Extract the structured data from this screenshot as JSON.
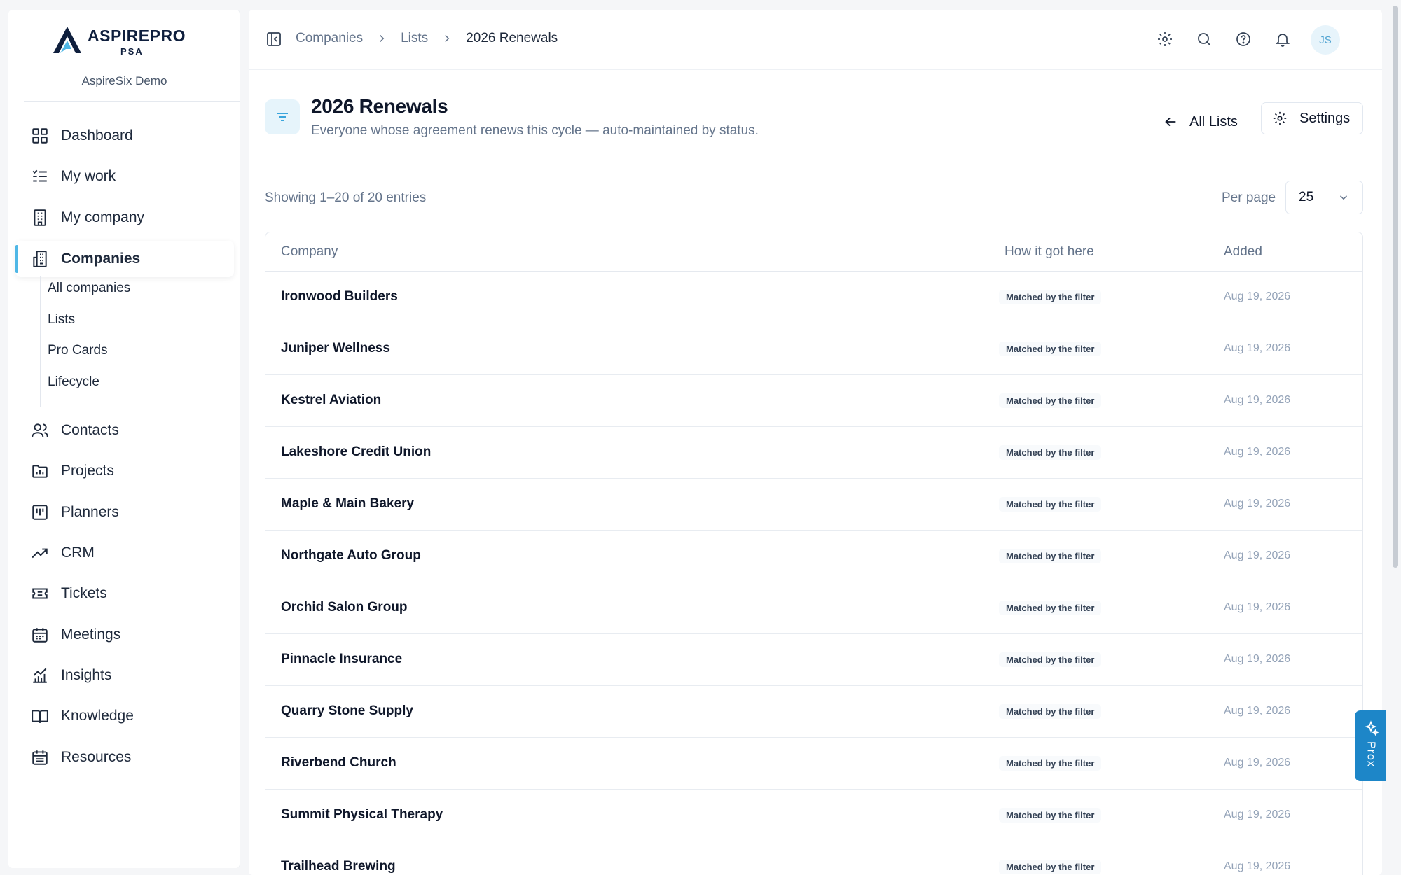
{
  "brand": {
    "logo_text": "ASPIREPRO",
    "logo_sub": "PSA",
    "tenant": "AspireSix Demo"
  },
  "sidebar": {
    "items": [
      {
        "label": "Dashboard",
        "icon": "dashboard-grid-icon"
      },
      {
        "label": "My work",
        "icon": "checklist-icon"
      },
      {
        "label": "My company",
        "icon": "building-icon"
      },
      {
        "label": "Companies",
        "icon": "buildings-icon",
        "active": true
      },
      {
        "label": "Contacts",
        "icon": "users-icon"
      },
      {
        "label": "Projects",
        "icon": "folder-chart-icon"
      },
      {
        "label": "Planners",
        "icon": "kanban-icon"
      },
      {
        "label": "CRM",
        "icon": "trending-up-icon"
      },
      {
        "label": "Tickets",
        "icon": "ticket-icon"
      },
      {
        "label": "Meetings",
        "icon": "calendar-icon"
      },
      {
        "label": "Insights",
        "icon": "bar-chart-icon"
      },
      {
        "label": "Knowledge",
        "icon": "book-open-icon"
      },
      {
        "label": "Resources",
        "icon": "calendar-list-icon"
      }
    ],
    "companies_sub": [
      "All companies",
      "Lists",
      "Pro Cards",
      "Lifecycle"
    ]
  },
  "topbar": {
    "breadcrumbs": [
      "Companies",
      "Lists",
      "2026 Renewals"
    ],
    "avatar_initials": "JS",
    "icons": [
      "settings-icon",
      "search-icon",
      "help-icon",
      "bell-icon"
    ]
  },
  "page": {
    "title": "2026 Renewals",
    "description": "Everyone whose agreement renews this cycle — auto-maintained by status.",
    "all_lists_label": "All Lists",
    "settings_label": "Settings",
    "showing": "Showing 1–20 of 20 entries",
    "per_page_label": "Per page",
    "per_page_value": "25"
  },
  "table": {
    "columns": [
      "Company",
      "How it got here",
      "Added"
    ],
    "rows": [
      {
        "company": "Ironwood Builders",
        "how": "Matched by the filter",
        "added": "Aug 19, 2026"
      },
      {
        "company": "Juniper Wellness",
        "how": "Matched by the filter",
        "added": "Aug 19, 2026"
      },
      {
        "company": "Kestrel Aviation",
        "how": "Matched by the filter",
        "added": "Aug 19, 2026"
      },
      {
        "company": "Lakeshore Credit Union",
        "how": "Matched by the filter",
        "added": "Aug 19, 2026"
      },
      {
        "company": "Maple & Main Bakery",
        "how": "Matched by the filter",
        "added": "Aug 19, 2026"
      },
      {
        "company": "Northgate Auto Group",
        "how": "Matched by the filter",
        "added": "Aug 19, 2026"
      },
      {
        "company": "Orchid Salon Group",
        "how": "Matched by the filter",
        "added": "Aug 19, 2026"
      },
      {
        "company": "Pinnacle Insurance",
        "how": "Matched by the filter",
        "added": "Aug 19, 2026"
      },
      {
        "company": "Quarry Stone Supply",
        "how": "Matched by the filter",
        "added": "Aug 19, 2026"
      },
      {
        "company": "Riverbend Church",
        "how": "Matched by the filter",
        "added": "Aug 19, 2026"
      },
      {
        "company": "Summit Physical Therapy",
        "how": "Matched by the filter",
        "added": "Aug 19, 2026"
      },
      {
        "company": "Trailhead Brewing",
        "how": "Matched by the filter",
        "added": "Aug 19, 2026"
      }
    ]
  },
  "prox_tab": {
    "label": "Prox",
    "icon": "sparkle-icon"
  },
  "colors": {
    "accent": "#4fb7e6",
    "prox_tab": "#1d86c8",
    "text": "#1e293b",
    "muted": "#64748b"
  }
}
